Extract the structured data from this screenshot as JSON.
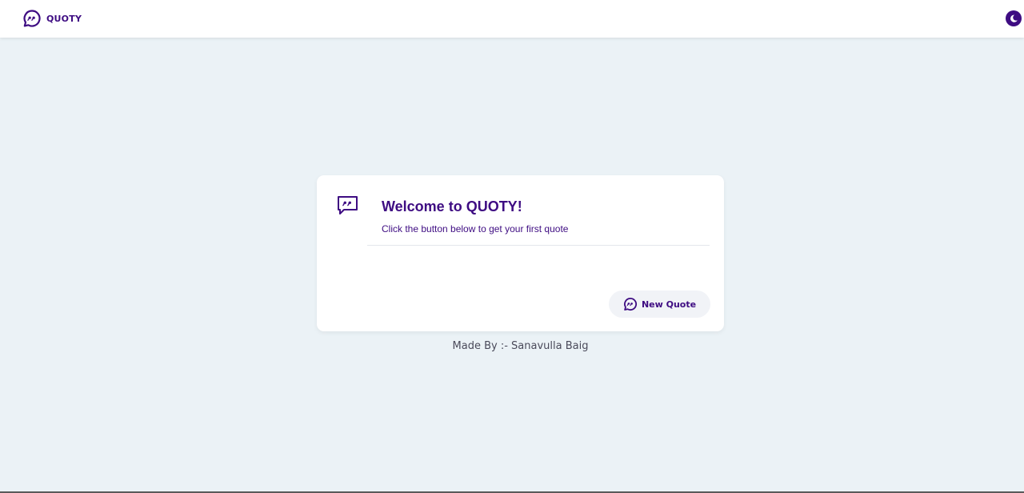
{
  "navbar": {
    "brand_name": "QUOTY",
    "logo_icon": "speech-bubble-quote-icon",
    "theme_toggle_icon": "moon-icon"
  },
  "card": {
    "icon": "quote-bubble-icon",
    "title": "Welcome to QUOTY!",
    "subtitle": "Click the button below to get your first quote",
    "button_label": "New Quote",
    "button_icon": "speech-bubble-quote-icon"
  },
  "footer": {
    "credit": "Made By :- Sanavulla Baig"
  },
  "colors": {
    "accent": "#3e0c82",
    "background": "#ebf2f6",
    "card_background": "#ffffff",
    "button_background": "#f1f3f7"
  }
}
